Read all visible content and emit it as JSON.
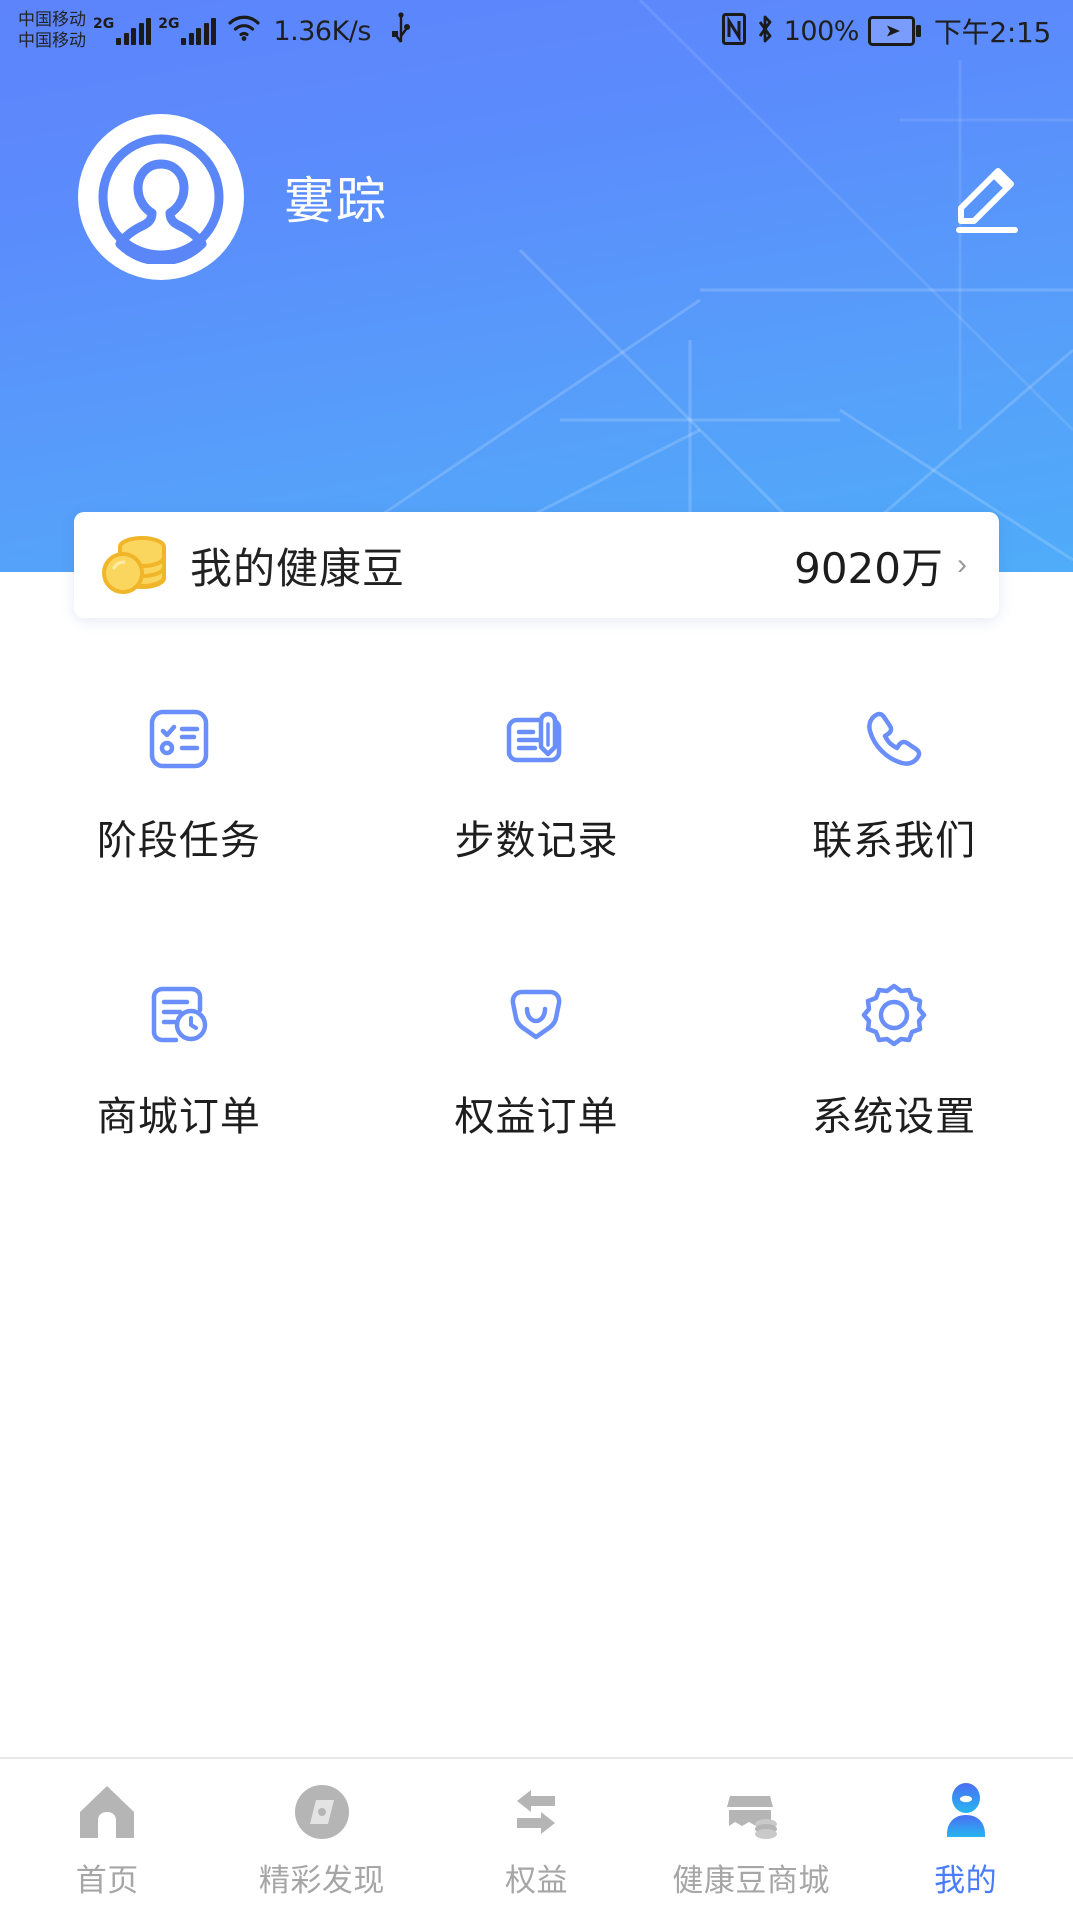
{
  "status_bar": {
    "carrier_primary": "中国移动",
    "carrier_secondary": "中国移动",
    "network_gen_sim1": "2G",
    "network_gen_sim2": "2G",
    "network_speed": "1.36K/s",
    "battery_percent": "100%",
    "time": "下午2:15",
    "icons": [
      "signal-bars-icon",
      "signal-bars-icon",
      "wifi-icon",
      "usb-icon",
      "nfc-icon",
      "bluetooth-icon",
      "battery-charging-icon"
    ]
  },
  "header": {
    "username": "寠踪",
    "avatar_icon": "user-avatar-icon",
    "edit_icon": "pencil-edit-icon",
    "gradient_from": "#5d84fb",
    "gradient_to": "#4facf9"
  },
  "beans_card": {
    "icon": "coin-stack-icon",
    "label": "我的健康豆",
    "value": "9020万",
    "chevron": "›",
    "accent_color": "#f5c544"
  },
  "grid_menu": {
    "items": [
      {
        "label": "阶段任务",
        "icon": "checklist-icon"
      },
      {
        "label": "步数记录",
        "icon": "note-pen-icon"
      },
      {
        "label": "联系我们",
        "icon": "phone-icon"
      },
      {
        "label": "商城订单",
        "icon": "order-clock-icon"
      },
      {
        "label": "权益订单",
        "icon": "gem-shield-icon"
      },
      {
        "label": "系统设置",
        "icon": "gear-icon"
      }
    ],
    "icon_color": "#6a8ffb"
  },
  "tab_bar": {
    "active_index": 4,
    "active_color": "#4a7dfb",
    "inactive_color": "#b5b5b5",
    "items": [
      {
        "label": "首页",
        "icon": "home-icon"
      },
      {
        "label": "精彩发现",
        "icon": "compass-icon"
      },
      {
        "label": "权益",
        "icon": "exchange-arrows-icon"
      },
      {
        "label": "健康豆商城",
        "icon": "shop-coins-icon"
      },
      {
        "label": "我的",
        "icon": "person-icon"
      }
    ]
  }
}
